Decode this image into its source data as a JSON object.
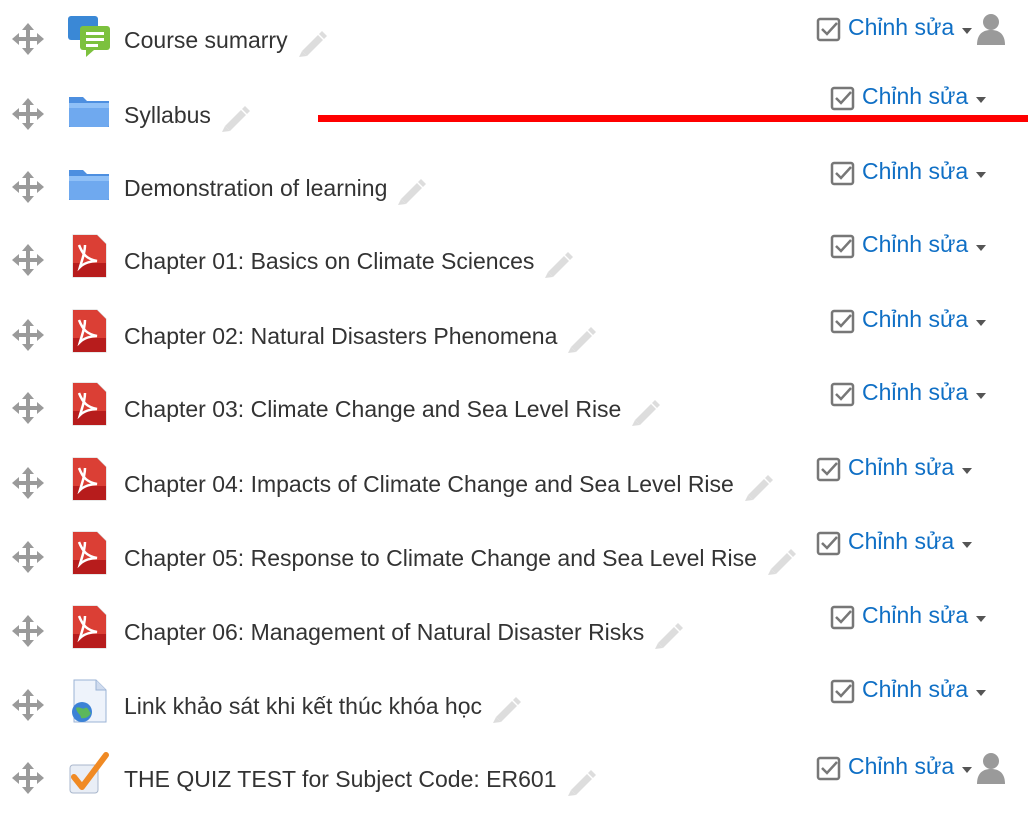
{
  "colors": {
    "link": "#0f6fc5",
    "title": "#333333",
    "red_line": "#ff0000"
  },
  "activities": [
    {
      "title": "Course sumarry",
      "icon": "forum-icon",
      "edit_label": "Chỉnh sửa",
      "has_user_icon": true
    },
    {
      "title": "Syllabus",
      "icon": "folder-icon",
      "edit_label": "Chỉnh sửa",
      "has_user_icon": false
    },
    {
      "title": "Demonstration of learning",
      "icon": "folder-icon",
      "edit_label": "Chỉnh sửa",
      "has_user_icon": false
    },
    {
      "title": "Chapter 01: Basics on Climate Sciences",
      "icon": "pdf-icon",
      "edit_label": "Chỉnh sửa",
      "has_user_icon": false
    },
    {
      "title": "Chapter 02: Natural Disasters Phenomena",
      "icon": "pdf-icon",
      "edit_label": "Chỉnh sửa",
      "has_user_icon": false
    },
    {
      "title": "Chapter 03: Climate Change and Sea Level Rise",
      "icon": "pdf-icon",
      "edit_label": "Chỉnh sửa",
      "has_user_icon": false
    },
    {
      "title": "Chapter 04: Impacts of Climate Change and Sea Level Rise",
      "icon": "pdf-icon",
      "edit_label": "Chỉnh sửa",
      "has_user_icon": false
    },
    {
      "title": "Chapter 05: Response to Climate Change and Sea Level Rise",
      "icon": "pdf-icon",
      "edit_label": "Chỉnh sửa",
      "has_user_icon": false
    },
    {
      "title": "Chapter 06: Management of Natural Disaster Risks",
      "icon": "pdf-icon",
      "edit_label": "Chỉnh sửa",
      "has_user_icon": false
    },
    {
      "title": "Link khảo sát khi kết thúc khóa học",
      "icon": "url-icon",
      "edit_label": "Chỉnh sửa",
      "has_user_icon": false
    },
    {
      "title": "THE QUIZ TEST for Subject Code: ER601",
      "icon": "quiz-icon",
      "edit_label": "Chỉnh sửa",
      "has_user_icon": true
    }
  ]
}
